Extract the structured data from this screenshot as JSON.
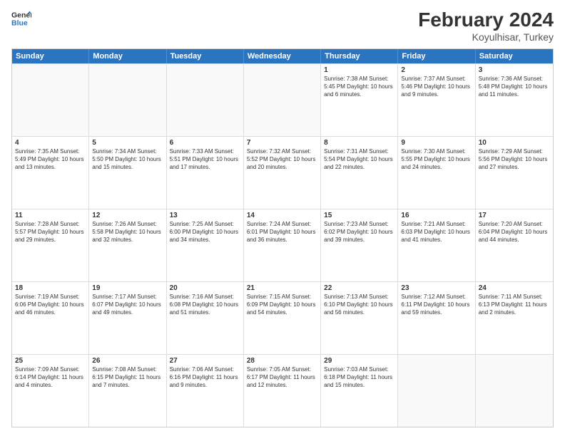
{
  "header": {
    "logo_line1": "General",
    "logo_line2": "Blue",
    "title": "February 2024",
    "subtitle": "Koyulhisar, Turkey"
  },
  "days_of_week": [
    "Sunday",
    "Monday",
    "Tuesday",
    "Wednesday",
    "Thursday",
    "Friday",
    "Saturday"
  ],
  "weeks": [
    [
      {
        "day": "",
        "info": ""
      },
      {
        "day": "",
        "info": ""
      },
      {
        "day": "",
        "info": ""
      },
      {
        "day": "",
        "info": ""
      },
      {
        "day": "1",
        "info": "Sunrise: 7:38 AM\nSunset: 5:45 PM\nDaylight: 10 hours\nand 6 minutes."
      },
      {
        "day": "2",
        "info": "Sunrise: 7:37 AM\nSunset: 5:46 PM\nDaylight: 10 hours\nand 9 minutes."
      },
      {
        "day": "3",
        "info": "Sunrise: 7:36 AM\nSunset: 5:48 PM\nDaylight: 10 hours\nand 11 minutes."
      }
    ],
    [
      {
        "day": "4",
        "info": "Sunrise: 7:35 AM\nSunset: 5:49 PM\nDaylight: 10 hours\nand 13 minutes."
      },
      {
        "day": "5",
        "info": "Sunrise: 7:34 AM\nSunset: 5:50 PM\nDaylight: 10 hours\nand 15 minutes."
      },
      {
        "day": "6",
        "info": "Sunrise: 7:33 AM\nSunset: 5:51 PM\nDaylight: 10 hours\nand 17 minutes."
      },
      {
        "day": "7",
        "info": "Sunrise: 7:32 AM\nSunset: 5:52 PM\nDaylight: 10 hours\nand 20 minutes."
      },
      {
        "day": "8",
        "info": "Sunrise: 7:31 AM\nSunset: 5:54 PM\nDaylight: 10 hours\nand 22 minutes."
      },
      {
        "day": "9",
        "info": "Sunrise: 7:30 AM\nSunset: 5:55 PM\nDaylight: 10 hours\nand 24 minutes."
      },
      {
        "day": "10",
        "info": "Sunrise: 7:29 AM\nSunset: 5:56 PM\nDaylight: 10 hours\nand 27 minutes."
      }
    ],
    [
      {
        "day": "11",
        "info": "Sunrise: 7:28 AM\nSunset: 5:57 PM\nDaylight: 10 hours\nand 29 minutes."
      },
      {
        "day": "12",
        "info": "Sunrise: 7:26 AM\nSunset: 5:58 PM\nDaylight: 10 hours\nand 32 minutes."
      },
      {
        "day": "13",
        "info": "Sunrise: 7:25 AM\nSunset: 6:00 PM\nDaylight: 10 hours\nand 34 minutes."
      },
      {
        "day": "14",
        "info": "Sunrise: 7:24 AM\nSunset: 6:01 PM\nDaylight: 10 hours\nand 36 minutes."
      },
      {
        "day": "15",
        "info": "Sunrise: 7:23 AM\nSunset: 6:02 PM\nDaylight: 10 hours\nand 39 minutes."
      },
      {
        "day": "16",
        "info": "Sunrise: 7:21 AM\nSunset: 6:03 PM\nDaylight: 10 hours\nand 41 minutes."
      },
      {
        "day": "17",
        "info": "Sunrise: 7:20 AM\nSunset: 6:04 PM\nDaylight: 10 hours\nand 44 minutes."
      }
    ],
    [
      {
        "day": "18",
        "info": "Sunrise: 7:19 AM\nSunset: 6:06 PM\nDaylight: 10 hours\nand 46 minutes."
      },
      {
        "day": "19",
        "info": "Sunrise: 7:17 AM\nSunset: 6:07 PM\nDaylight: 10 hours\nand 49 minutes."
      },
      {
        "day": "20",
        "info": "Sunrise: 7:16 AM\nSunset: 6:08 PM\nDaylight: 10 hours\nand 51 minutes."
      },
      {
        "day": "21",
        "info": "Sunrise: 7:15 AM\nSunset: 6:09 PM\nDaylight: 10 hours\nand 54 minutes."
      },
      {
        "day": "22",
        "info": "Sunrise: 7:13 AM\nSunset: 6:10 PM\nDaylight: 10 hours\nand 56 minutes."
      },
      {
        "day": "23",
        "info": "Sunrise: 7:12 AM\nSunset: 6:11 PM\nDaylight: 10 hours\nand 59 minutes."
      },
      {
        "day": "24",
        "info": "Sunrise: 7:11 AM\nSunset: 6:13 PM\nDaylight: 11 hours\nand 2 minutes."
      }
    ],
    [
      {
        "day": "25",
        "info": "Sunrise: 7:09 AM\nSunset: 6:14 PM\nDaylight: 11 hours\nand 4 minutes."
      },
      {
        "day": "26",
        "info": "Sunrise: 7:08 AM\nSunset: 6:15 PM\nDaylight: 11 hours\nand 7 minutes."
      },
      {
        "day": "27",
        "info": "Sunrise: 7:06 AM\nSunset: 6:16 PM\nDaylight: 11 hours\nand 9 minutes."
      },
      {
        "day": "28",
        "info": "Sunrise: 7:05 AM\nSunset: 6:17 PM\nDaylight: 11 hours\nand 12 minutes."
      },
      {
        "day": "29",
        "info": "Sunrise: 7:03 AM\nSunset: 6:18 PM\nDaylight: 11 hours\nand 15 minutes."
      },
      {
        "day": "",
        "info": ""
      },
      {
        "day": "",
        "info": ""
      }
    ]
  ]
}
